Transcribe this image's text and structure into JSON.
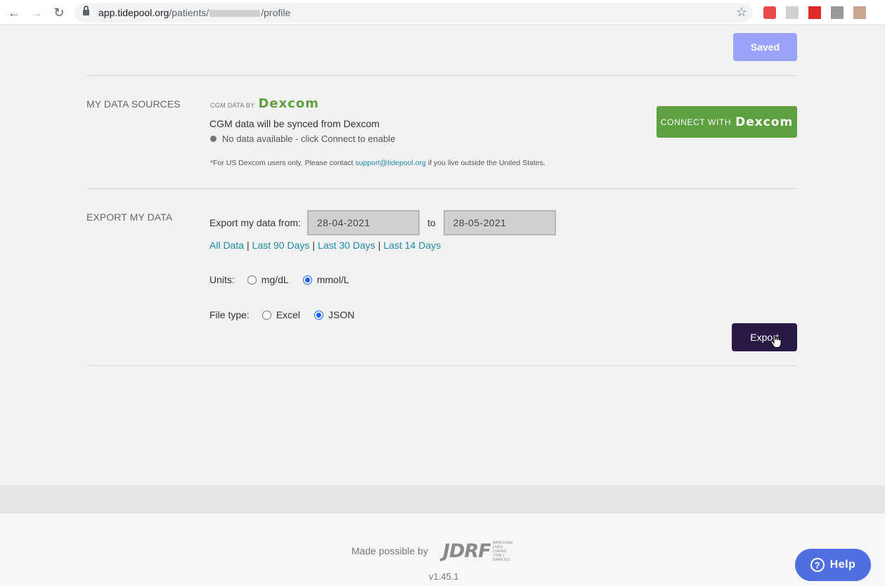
{
  "browser": {
    "url_host": "app.tidepool.org",
    "url_path_prefix": "/patients/",
    "url_path_suffix": "/profile"
  },
  "header": {
    "saved_label": "Saved"
  },
  "data_sources": {
    "section_title": "MY DATA SOURCES",
    "cgm_data_by": "CGM DATA BY",
    "brand": "Dexcom",
    "sync_text": "CGM data will be synced from Dexcom",
    "status_text": "No data available - click Connect to enable",
    "note_prefix": "*For US Dexcom users only. Please contact ",
    "note_link": "support@tidepool.org",
    "note_suffix": " if you live outside the United States.",
    "connect_label": "CONNECT WITH",
    "connect_brand": "Dexcom",
    "connect_color": "#5ea03f"
  },
  "export": {
    "section_title": "EXPORT MY DATA",
    "from_label": "Export my data from:",
    "start_date": "28-04-2021",
    "to_label": "to",
    "end_date": "28-05-2021",
    "range_links": [
      "All Data",
      "Last 90 Days",
      "Last 30 Days",
      "Last 14 Days"
    ],
    "units_label": "Units:",
    "units_options": [
      {
        "label": "mg/dL",
        "checked": false
      },
      {
        "label": "mmol/L",
        "checked": true
      }
    ],
    "filetype_label": "File type:",
    "filetype_options": [
      {
        "label": "Excel",
        "checked": false
      },
      {
        "label": "JSON",
        "checked": true
      }
    ],
    "export_label": "Export",
    "export_color": "#281946"
  },
  "footer": {
    "made_possible_by": "Made possible by",
    "sponsor": "JDRF",
    "sponsor_tagline": [
      "IMPROVING",
      "LIVES.",
      "CURING",
      "TYPE 1",
      "DIABETES."
    ],
    "version": "v1.45.1"
  },
  "help": {
    "label": "Help"
  }
}
